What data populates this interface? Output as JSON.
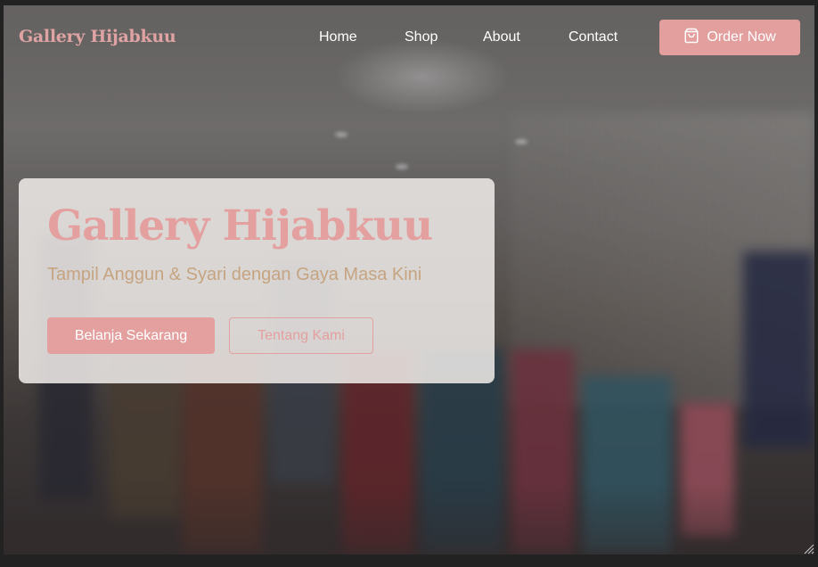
{
  "brand": {
    "name": "Gallery Hijabkuu",
    "color": "#e0a3a3"
  },
  "nav": {
    "links": [
      {
        "label": "Home"
      },
      {
        "label": "Shop"
      },
      {
        "label": "About"
      },
      {
        "label": "Contact"
      }
    ],
    "order_button": {
      "label": "Order Now",
      "icon": "shopping-bag-icon"
    }
  },
  "hero": {
    "title": "Gallery Hijabkuu",
    "subtitle": "Tampil Anggun & Syari dengan Gaya Masa Kini",
    "primary_button": "Belanja Sekarang",
    "secondary_button": "Tentang Kami"
  },
  "colors": {
    "accent": "#e3a09f",
    "subtitle": "#c6a481",
    "nav_text": "#ffffff"
  }
}
